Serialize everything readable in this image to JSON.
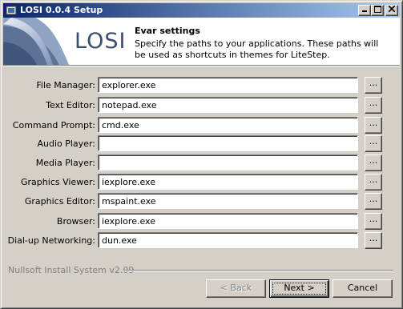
{
  "window": {
    "title": "LOSI 0.0.4 Setup",
    "controls": [
      "minimize",
      "maximize",
      "close"
    ]
  },
  "header": {
    "logo_text": "LOSI",
    "title": "Evar settings",
    "description": "Specify the paths to your applications. These paths will be used as shortcuts in themes for LiteStep."
  },
  "fields": [
    {
      "label": "File Manager:",
      "value": "explorer.exe"
    },
    {
      "label": "Text Editor:",
      "value": "notepad.exe"
    },
    {
      "label": "Command Prompt:",
      "value": "cmd.exe"
    },
    {
      "label": "Audio Player:",
      "value": ""
    },
    {
      "label": "Media Player:",
      "value": ""
    },
    {
      "label": "Graphics Viewer:",
      "value": "iexplore.exe"
    },
    {
      "label": "Graphics Editor:",
      "value": "mspaint.exe"
    },
    {
      "label": "Browser:",
      "value": "iexplore.exe"
    },
    {
      "label": "Dial-up Networking:",
      "value": "dun.exe"
    }
  ],
  "browse_label": "...",
  "footer": {
    "brand": "Nullsoft Install System v2.09",
    "back_label": "< Back",
    "next_label": "Next >",
    "cancel_label": "Cancel"
  }
}
